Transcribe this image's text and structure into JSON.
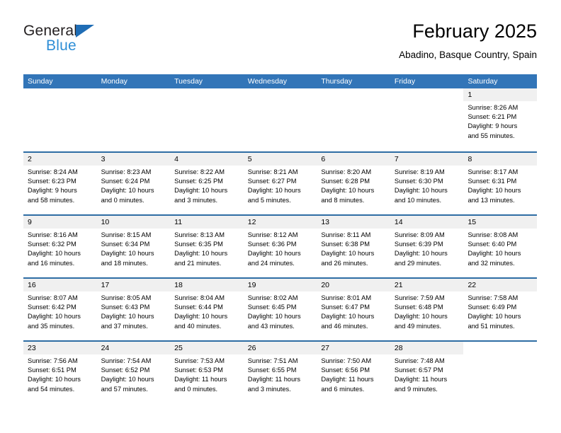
{
  "brand": {
    "name_part1": "General",
    "name_part2": "Blue",
    "accent_color": "#2e8ed6",
    "triangle_color": "#1f6db5"
  },
  "header": {
    "title": "February 2025",
    "subtitle": "Abadino, Basque Country, Spain"
  },
  "calendar": {
    "header_bg": "#3275b8",
    "row_divider_color": "#2e6da4",
    "day_band_bg": "#f0f0f0",
    "weekdays": [
      "Sunday",
      "Monday",
      "Tuesday",
      "Wednesday",
      "Thursday",
      "Friday",
      "Saturday"
    ],
    "weeks": [
      [
        {
          "day": "",
          "sunrise": "",
          "sunset": "",
          "daylight_line1": "",
          "daylight_line2": "",
          "blank": true
        },
        {
          "day": "",
          "sunrise": "",
          "sunset": "",
          "daylight_line1": "",
          "daylight_line2": "",
          "blank": true
        },
        {
          "day": "",
          "sunrise": "",
          "sunset": "",
          "daylight_line1": "",
          "daylight_line2": "",
          "blank": true
        },
        {
          "day": "",
          "sunrise": "",
          "sunset": "",
          "daylight_line1": "",
          "daylight_line2": "",
          "blank": true
        },
        {
          "day": "",
          "sunrise": "",
          "sunset": "",
          "daylight_line1": "",
          "daylight_line2": "",
          "blank": true
        },
        {
          "day": "",
          "sunrise": "",
          "sunset": "",
          "daylight_line1": "",
          "daylight_line2": "",
          "blank": true
        },
        {
          "day": "1",
          "sunrise": "Sunrise: 8:26 AM",
          "sunset": "Sunset: 6:21 PM",
          "daylight_line1": "Daylight: 9 hours",
          "daylight_line2": "and 55 minutes.",
          "blank": false
        }
      ],
      [
        {
          "day": "2",
          "sunrise": "Sunrise: 8:24 AM",
          "sunset": "Sunset: 6:23 PM",
          "daylight_line1": "Daylight: 9 hours",
          "daylight_line2": "and 58 minutes.",
          "blank": false
        },
        {
          "day": "3",
          "sunrise": "Sunrise: 8:23 AM",
          "sunset": "Sunset: 6:24 PM",
          "daylight_line1": "Daylight: 10 hours",
          "daylight_line2": "and 0 minutes.",
          "blank": false
        },
        {
          "day": "4",
          "sunrise": "Sunrise: 8:22 AM",
          "sunset": "Sunset: 6:25 PM",
          "daylight_line1": "Daylight: 10 hours",
          "daylight_line2": "and 3 minutes.",
          "blank": false
        },
        {
          "day": "5",
          "sunrise": "Sunrise: 8:21 AM",
          "sunset": "Sunset: 6:27 PM",
          "daylight_line1": "Daylight: 10 hours",
          "daylight_line2": "and 5 minutes.",
          "blank": false
        },
        {
          "day": "6",
          "sunrise": "Sunrise: 8:20 AM",
          "sunset": "Sunset: 6:28 PM",
          "daylight_line1": "Daylight: 10 hours",
          "daylight_line2": "and 8 minutes.",
          "blank": false
        },
        {
          "day": "7",
          "sunrise": "Sunrise: 8:19 AM",
          "sunset": "Sunset: 6:30 PM",
          "daylight_line1": "Daylight: 10 hours",
          "daylight_line2": "and 10 minutes.",
          "blank": false
        },
        {
          "day": "8",
          "sunrise": "Sunrise: 8:17 AM",
          "sunset": "Sunset: 6:31 PM",
          "daylight_line1": "Daylight: 10 hours",
          "daylight_line2": "and 13 minutes.",
          "blank": false
        }
      ],
      [
        {
          "day": "9",
          "sunrise": "Sunrise: 8:16 AM",
          "sunset": "Sunset: 6:32 PM",
          "daylight_line1": "Daylight: 10 hours",
          "daylight_line2": "and 16 minutes.",
          "blank": false
        },
        {
          "day": "10",
          "sunrise": "Sunrise: 8:15 AM",
          "sunset": "Sunset: 6:34 PM",
          "daylight_line1": "Daylight: 10 hours",
          "daylight_line2": "and 18 minutes.",
          "blank": false
        },
        {
          "day": "11",
          "sunrise": "Sunrise: 8:13 AM",
          "sunset": "Sunset: 6:35 PM",
          "daylight_line1": "Daylight: 10 hours",
          "daylight_line2": "and 21 minutes.",
          "blank": false
        },
        {
          "day": "12",
          "sunrise": "Sunrise: 8:12 AM",
          "sunset": "Sunset: 6:36 PM",
          "daylight_line1": "Daylight: 10 hours",
          "daylight_line2": "and 24 minutes.",
          "blank": false
        },
        {
          "day": "13",
          "sunrise": "Sunrise: 8:11 AM",
          "sunset": "Sunset: 6:38 PM",
          "daylight_line1": "Daylight: 10 hours",
          "daylight_line2": "and 26 minutes.",
          "blank": false
        },
        {
          "day": "14",
          "sunrise": "Sunrise: 8:09 AM",
          "sunset": "Sunset: 6:39 PM",
          "daylight_line1": "Daylight: 10 hours",
          "daylight_line2": "and 29 minutes.",
          "blank": false
        },
        {
          "day": "15",
          "sunrise": "Sunrise: 8:08 AM",
          "sunset": "Sunset: 6:40 PM",
          "daylight_line1": "Daylight: 10 hours",
          "daylight_line2": "and 32 minutes.",
          "blank": false
        }
      ],
      [
        {
          "day": "16",
          "sunrise": "Sunrise: 8:07 AM",
          "sunset": "Sunset: 6:42 PM",
          "daylight_line1": "Daylight: 10 hours",
          "daylight_line2": "and 35 minutes.",
          "blank": false
        },
        {
          "day": "17",
          "sunrise": "Sunrise: 8:05 AM",
          "sunset": "Sunset: 6:43 PM",
          "daylight_line1": "Daylight: 10 hours",
          "daylight_line2": "and 37 minutes.",
          "blank": false
        },
        {
          "day": "18",
          "sunrise": "Sunrise: 8:04 AM",
          "sunset": "Sunset: 6:44 PM",
          "daylight_line1": "Daylight: 10 hours",
          "daylight_line2": "and 40 minutes.",
          "blank": false
        },
        {
          "day": "19",
          "sunrise": "Sunrise: 8:02 AM",
          "sunset": "Sunset: 6:45 PM",
          "daylight_line1": "Daylight: 10 hours",
          "daylight_line2": "and 43 minutes.",
          "blank": false
        },
        {
          "day": "20",
          "sunrise": "Sunrise: 8:01 AM",
          "sunset": "Sunset: 6:47 PM",
          "daylight_line1": "Daylight: 10 hours",
          "daylight_line2": "and 46 minutes.",
          "blank": false
        },
        {
          "day": "21",
          "sunrise": "Sunrise: 7:59 AM",
          "sunset": "Sunset: 6:48 PM",
          "daylight_line1": "Daylight: 10 hours",
          "daylight_line2": "and 49 minutes.",
          "blank": false
        },
        {
          "day": "22",
          "sunrise": "Sunrise: 7:58 AM",
          "sunset": "Sunset: 6:49 PM",
          "daylight_line1": "Daylight: 10 hours",
          "daylight_line2": "and 51 minutes.",
          "blank": false
        }
      ],
      [
        {
          "day": "23",
          "sunrise": "Sunrise: 7:56 AM",
          "sunset": "Sunset: 6:51 PM",
          "daylight_line1": "Daylight: 10 hours",
          "daylight_line2": "and 54 minutes.",
          "blank": false
        },
        {
          "day": "24",
          "sunrise": "Sunrise: 7:54 AM",
          "sunset": "Sunset: 6:52 PM",
          "daylight_line1": "Daylight: 10 hours",
          "daylight_line2": "and 57 minutes.",
          "blank": false
        },
        {
          "day": "25",
          "sunrise": "Sunrise: 7:53 AM",
          "sunset": "Sunset: 6:53 PM",
          "daylight_line1": "Daylight: 11 hours",
          "daylight_line2": "and 0 minutes.",
          "blank": false
        },
        {
          "day": "26",
          "sunrise": "Sunrise: 7:51 AM",
          "sunset": "Sunset: 6:55 PM",
          "daylight_line1": "Daylight: 11 hours",
          "daylight_line2": "and 3 minutes.",
          "blank": false
        },
        {
          "day": "27",
          "sunrise": "Sunrise: 7:50 AM",
          "sunset": "Sunset: 6:56 PM",
          "daylight_line1": "Daylight: 11 hours",
          "daylight_line2": "and 6 minutes.",
          "blank": false
        },
        {
          "day": "28",
          "sunrise": "Sunrise: 7:48 AM",
          "sunset": "Sunset: 6:57 PM",
          "daylight_line1": "Daylight: 11 hours",
          "daylight_line2": "and 9 minutes.",
          "blank": false
        },
        {
          "day": "",
          "sunrise": "",
          "sunset": "",
          "daylight_line1": "",
          "daylight_line2": "",
          "blank": true
        }
      ]
    ]
  }
}
